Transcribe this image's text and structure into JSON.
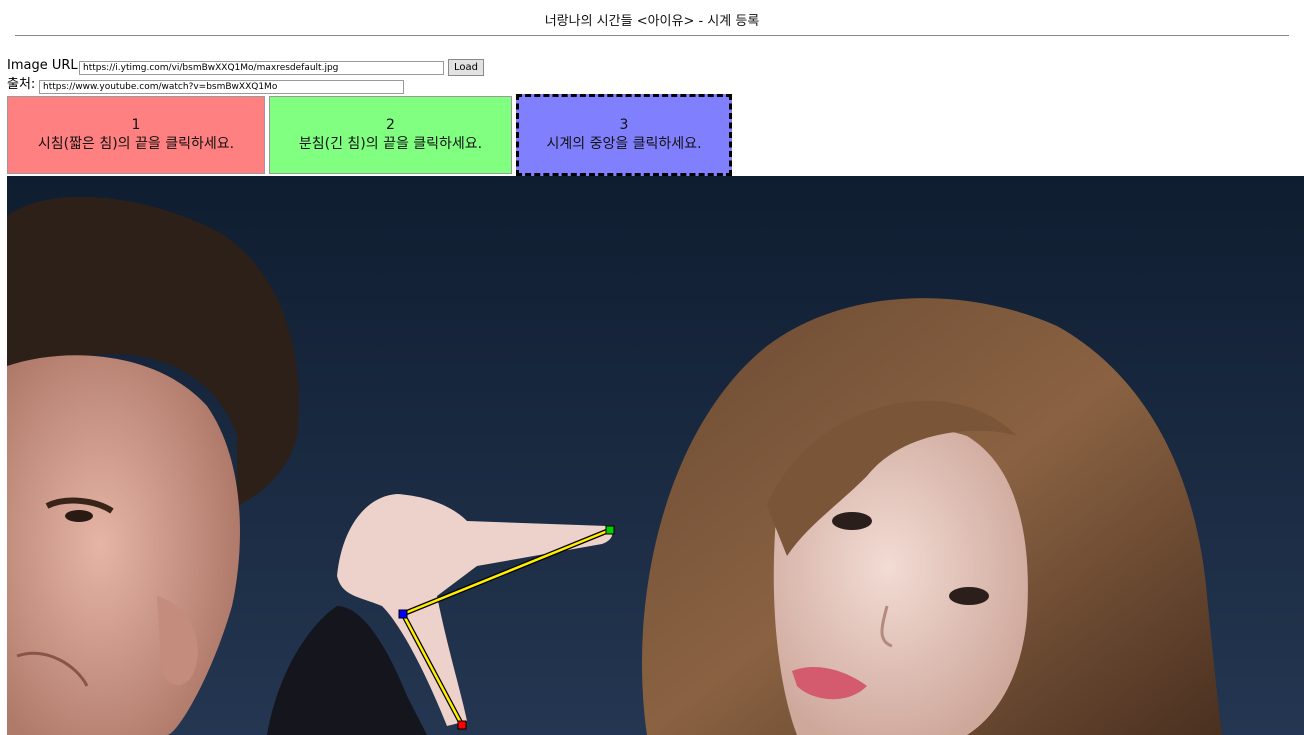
{
  "page": {
    "title": "너랑나의 시간들 <아이유> - 시계 등록"
  },
  "form": {
    "image_url_label": "Image URL:",
    "image_url_value": "https://i.ytimg.com/vi/bsmBwXXQ1Mo/maxresdefault.jpg",
    "load_label": "Load",
    "source_label": "출처:",
    "source_value": "https://www.youtube.com/watch?v=bsmBwXXQ1Mo"
  },
  "steps": [
    {
      "number": "1",
      "text": "시침(짧은 침)의 끝을 클릭하세요.",
      "color": "#ff8080",
      "active": false
    },
    {
      "number": "2",
      "text": "분침(긴 침)의 끝을 클릭하세요.",
      "color": "#80ff80",
      "active": false
    },
    {
      "number": "3",
      "text": "시계의 중앙을 클릭하세요.",
      "color": "#8080ff",
      "active": true
    }
  ],
  "markers": {
    "hour_end_color": "#ff0000",
    "minute_end_color": "#00cc00",
    "center_color": "#0000ff",
    "hand_color": "#ffee00"
  }
}
